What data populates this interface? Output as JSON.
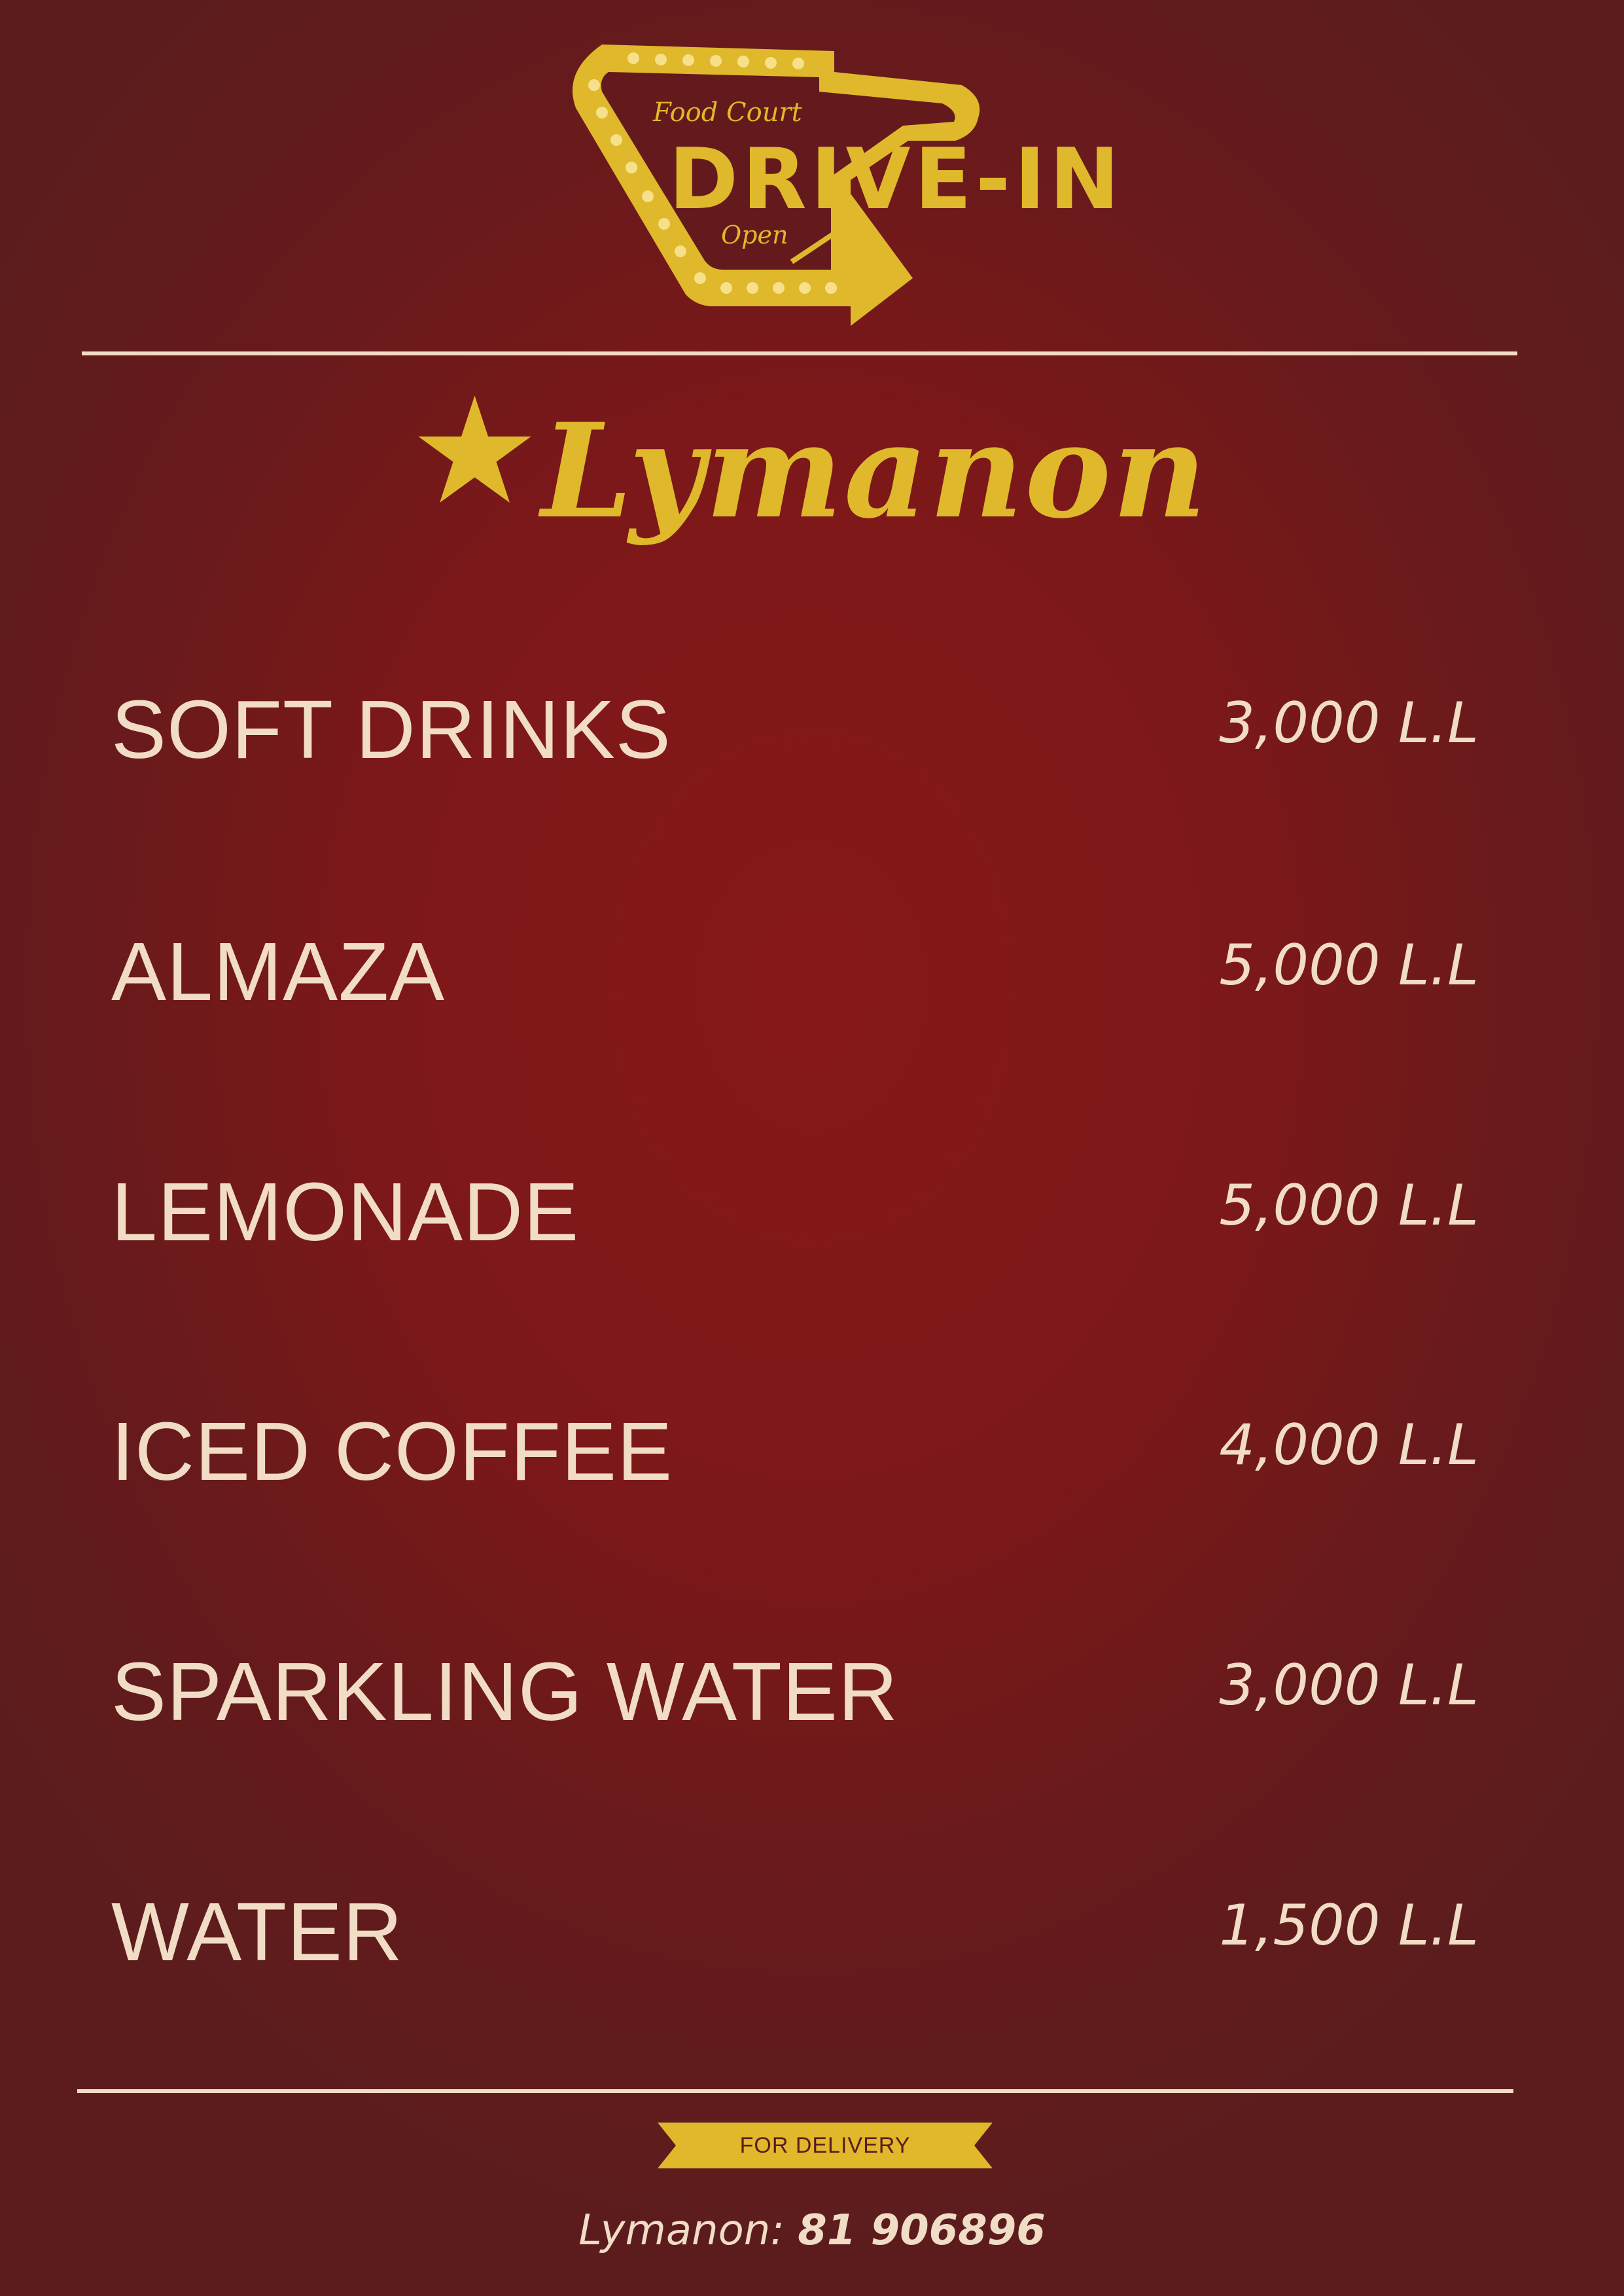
{
  "logo": {
    "top_text": "Food Court",
    "main_text": "DRIVE-IN",
    "bottom_text": "Open",
    "color": "#dfb82b",
    "bulb_color": "#f6e08a"
  },
  "brand": {
    "name": "Lymanon",
    "icon": "star-icon",
    "color": "#dfb82b"
  },
  "menu": {
    "items": [
      {
        "name": "SOFT DRINKS",
        "price": "3,000 L.L"
      },
      {
        "name": "ALMAZA",
        "price": "5,000 L.L"
      },
      {
        "name": "LEMONADE",
        "price": "5,000 L.L"
      },
      {
        "name": "ICED COFFEE",
        "price": "4,000 L.L"
      },
      {
        "name": "SPARKLING WATER",
        "price": "3,000 L.L"
      },
      {
        "name": "WATER",
        "price": "1,500 L.L"
      }
    ]
  },
  "footer": {
    "ribbon_label": "FOR DELIVERY",
    "contact_name": "Lymanon:",
    "contact_number": "81 906896"
  },
  "colors": {
    "background": "#7c1819",
    "text": "#f1dcc5",
    "accent": "#dfb82b"
  }
}
